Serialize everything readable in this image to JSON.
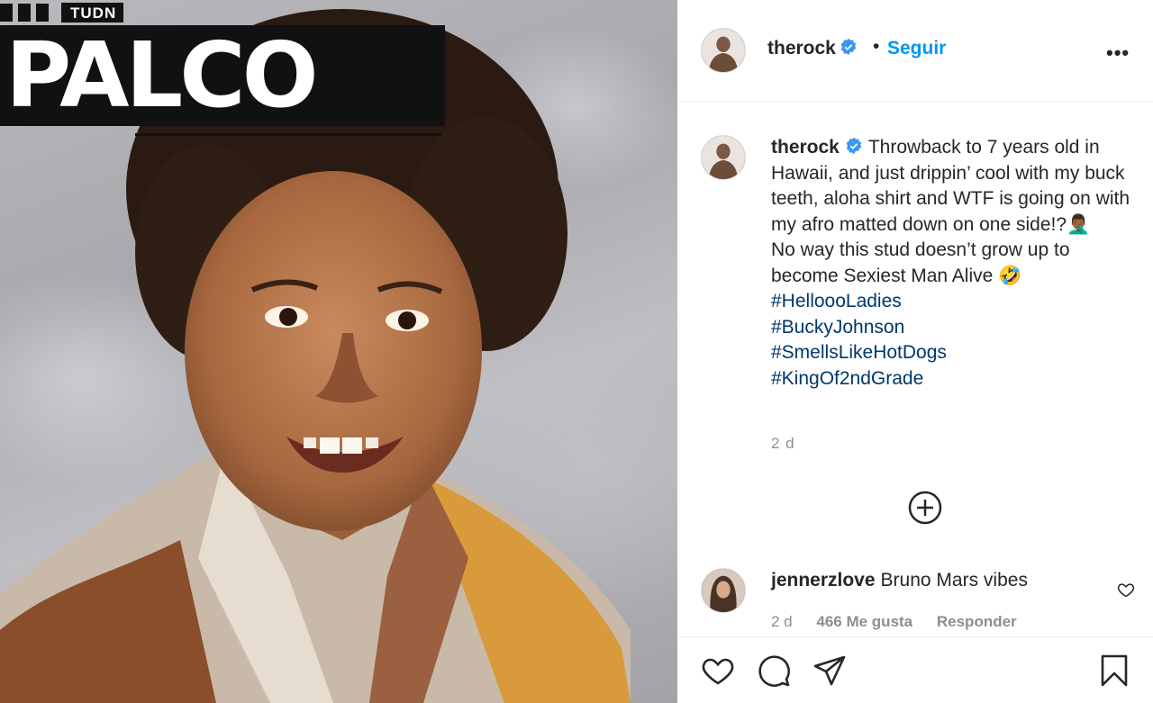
{
  "photo": {
    "logo": {
      "brand": "TUDN",
      "title": "PALCO"
    }
  },
  "header": {
    "username": "therock",
    "follow_label": "Seguir",
    "more_label": "•••"
  },
  "caption": {
    "username": "therock",
    "lines": [
      "Throwback to 7 years old in Hawaii, and just drippin’ cool with my buck teeth, aloha shirt and WTF is going on with my afro matted down on one side!?🤦🏾‍♂️",
      "No way this stud doesn’t grow up to become Sexiest Man Alive 🤣"
    ],
    "hashtags": [
      "#HelloooLadies",
      "#BuckyJohnson",
      "#SmellsLikeHotDogs",
      "#KingOf2ndGrade"
    ],
    "age": "2 d"
  },
  "comment": {
    "username": "jennerzlove",
    "text": "Bruno Mars vibes",
    "age": "2 d",
    "likes": "466 Me gusta",
    "reply": "Responder"
  },
  "colors": {
    "link_blue": "#0095f6",
    "hashtag_blue": "#00376b",
    "muted": "#8e8e8e",
    "text": "#262626"
  },
  "icons": [
    "verified-badge-icon",
    "more-options-icon",
    "add-circle-icon",
    "heart-icon",
    "comment-icon",
    "share-icon",
    "bookmark-icon"
  ]
}
